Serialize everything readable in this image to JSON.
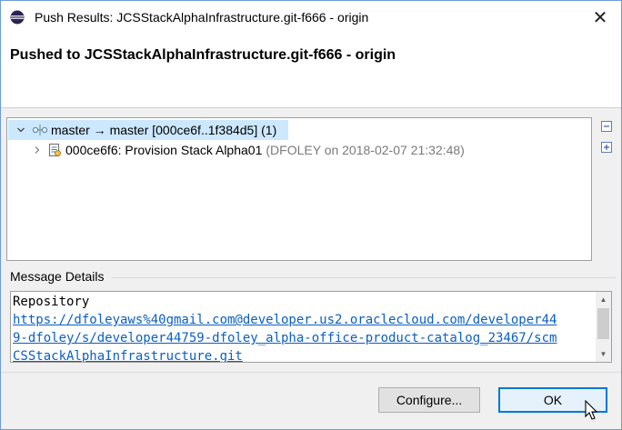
{
  "window": {
    "title": "Push Results: JCSStackAlphaInfrastructure.git-f666 - origin",
    "close_glyph": "✕"
  },
  "banner": {
    "title": "Pushed to JCSStackAlphaInfrastructure.git-f666 - origin"
  },
  "tree": {
    "ref_update": {
      "expander": "⌄",
      "icon": "branch-ref-icon",
      "label": "master → master [000ce6f..1f384d5] (1)"
    },
    "commit": {
      "expander": "›",
      "icon": "commit-icon",
      "label": "000ce6f6: Provision Stack Alpha01",
      "meta": "(DFOLEY on 2018-02-07 21:32:48)"
    },
    "side_buttons": {
      "collapse_all": "collapse-all-icon",
      "expand_all": "expand-all-icon"
    }
  },
  "message_details": {
    "label": "Message Details",
    "line1": "Repository",
    "link_line1": "https://dfoleyaws%40gmail.com@developer.us2.oraclecloud.com/developer44",
    "link_line2": "9-dfoley/s/developer44759-dfoley_alpha-office-product-catalog_23467/scm",
    "link_line3": "CSStackAlphaInfrastructure.git"
  },
  "buttons": {
    "configure": "Configure...",
    "ok": "OK"
  },
  "colors": {
    "selection": "#cce8ff",
    "link": "#0b5fc2",
    "default_button_border": "#0078d7"
  }
}
